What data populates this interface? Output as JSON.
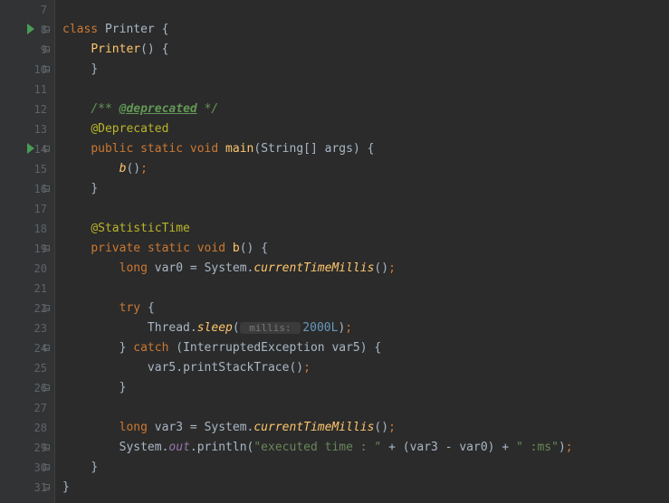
{
  "lines": [
    {
      "num": 7,
      "indent": 0,
      "tokens": []
    },
    {
      "num": 8,
      "indent": 0,
      "run": true,
      "fold": true,
      "tokens": [
        [
          "kw",
          "class"
        ],
        [
          "sp",
          " "
        ],
        [
          "cls",
          "Printer"
        ],
        [
          "sp",
          " "
        ],
        [
          "paren",
          "{"
        ]
      ]
    },
    {
      "num": 9,
      "indent": 1,
      "fold": true,
      "tokens": [
        [
          "method",
          "Printer"
        ],
        [
          "paren",
          "()"
        ],
        [
          "sp",
          " "
        ],
        [
          "paren",
          "{"
        ]
      ]
    },
    {
      "num": 10,
      "indent": 1,
      "fold": true,
      "tokens": [
        [
          "paren",
          "}"
        ]
      ]
    },
    {
      "num": 11,
      "indent": 0,
      "tokens": []
    },
    {
      "num": 12,
      "indent": 1,
      "tokens": [
        [
          "comment",
          "/** "
        ],
        [
          "doc-tag",
          "@deprecated"
        ],
        [
          "comment",
          " */"
        ]
      ]
    },
    {
      "num": 13,
      "indent": 1,
      "tokens": [
        [
          "ann",
          "@Deprecated"
        ]
      ]
    },
    {
      "num": 14,
      "indent": 1,
      "run": true,
      "fold": true,
      "tokens": [
        [
          "kw",
          "public"
        ],
        [
          "sp",
          " "
        ],
        [
          "kw",
          "static"
        ],
        [
          "sp",
          " "
        ],
        [
          "kw",
          "void"
        ],
        [
          "sp",
          " "
        ],
        [
          "method",
          "main"
        ],
        [
          "paren",
          "("
        ],
        [
          "type",
          "String"
        ],
        [
          "paren",
          "[]"
        ],
        [
          "sp",
          " "
        ],
        [
          "type",
          "args"
        ],
        [
          "paren",
          ")"
        ],
        [
          "sp",
          " "
        ],
        [
          "paren",
          "{"
        ]
      ]
    },
    {
      "num": 15,
      "indent": 2,
      "tokens": [
        [
          "static-method",
          "b"
        ],
        [
          "paren",
          "()"
        ],
        [
          "semi",
          ";"
        ]
      ]
    },
    {
      "num": 16,
      "indent": 1,
      "fold": true,
      "tokens": [
        [
          "paren",
          "}"
        ]
      ]
    },
    {
      "num": 17,
      "indent": 0,
      "tokens": []
    },
    {
      "num": 18,
      "indent": 1,
      "tokens": [
        [
          "ann",
          "@StatisticTime"
        ]
      ]
    },
    {
      "num": 19,
      "indent": 1,
      "fold": true,
      "tokens": [
        [
          "kw",
          "private"
        ],
        [
          "sp",
          " "
        ],
        [
          "kw",
          "static"
        ],
        [
          "sp",
          " "
        ],
        [
          "kw",
          "void"
        ],
        [
          "sp",
          " "
        ],
        [
          "method",
          "b"
        ],
        [
          "paren",
          "()"
        ],
        [
          "sp",
          " "
        ],
        [
          "paren",
          "{"
        ]
      ]
    },
    {
      "num": 20,
      "indent": 2,
      "tokens": [
        [
          "kw",
          "long"
        ],
        [
          "sp",
          " "
        ],
        [
          "type",
          "var0"
        ],
        [
          "sp",
          " "
        ],
        [
          "op",
          "="
        ],
        [
          "sp",
          " "
        ],
        [
          "type",
          "System"
        ],
        [
          "op",
          "."
        ],
        [
          "static-method",
          "currentTimeMillis"
        ],
        [
          "paren",
          "()"
        ],
        [
          "semi",
          ";"
        ]
      ]
    },
    {
      "num": 21,
      "indent": 0,
      "tokens": []
    },
    {
      "num": 22,
      "indent": 2,
      "fold": true,
      "tokens": [
        [
          "kw",
          "try"
        ],
        [
          "sp",
          " "
        ],
        [
          "paren",
          "{"
        ]
      ]
    },
    {
      "num": 23,
      "indent": 3,
      "tokens": [
        [
          "type",
          "Thread"
        ],
        [
          "op",
          "."
        ],
        [
          "static-method",
          "sleep"
        ],
        [
          "paren",
          "("
        ],
        [
          "param-hint",
          " millis: "
        ],
        [
          "num",
          "2000L"
        ],
        [
          "paren",
          ")"
        ],
        [
          "semi",
          ";"
        ]
      ]
    },
    {
      "num": 24,
      "indent": 2,
      "fold": true,
      "tokens": [
        [
          "paren",
          "}"
        ],
        [
          "sp",
          " "
        ],
        [
          "kw",
          "catch"
        ],
        [
          "sp",
          " "
        ],
        [
          "paren",
          "("
        ],
        [
          "type",
          "InterruptedException"
        ],
        [
          "sp",
          " "
        ],
        [
          "type",
          "var5"
        ],
        [
          "paren",
          ")"
        ],
        [
          "sp",
          " "
        ],
        [
          "paren",
          "{"
        ]
      ]
    },
    {
      "num": 25,
      "indent": 3,
      "tokens": [
        [
          "type",
          "var5"
        ],
        [
          "op",
          "."
        ],
        [
          "type",
          "printStackTrace"
        ],
        [
          "paren",
          "()"
        ],
        [
          "semi",
          ";"
        ]
      ]
    },
    {
      "num": 26,
      "indent": 2,
      "fold": true,
      "tokens": [
        [
          "paren",
          "}"
        ]
      ]
    },
    {
      "num": 27,
      "indent": 0,
      "tokens": []
    },
    {
      "num": 28,
      "indent": 2,
      "tokens": [
        [
          "kw",
          "long"
        ],
        [
          "sp",
          " "
        ],
        [
          "type",
          "var3"
        ],
        [
          "sp",
          " "
        ],
        [
          "op",
          "="
        ],
        [
          "sp",
          " "
        ],
        [
          "type",
          "System"
        ],
        [
          "op",
          "."
        ],
        [
          "static-method",
          "currentTimeMillis"
        ],
        [
          "paren",
          "()"
        ],
        [
          "semi",
          ";"
        ]
      ]
    },
    {
      "num": 29,
      "indent": 2,
      "fold": true,
      "tokens": [
        [
          "type",
          "System"
        ],
        [
          "op",
          "."
        ],
        [
          "static-field",
          "out"
        ],
        [
          "op",
          "."
        ],
        [
          "type",
          "println"
        ],
        [
          "paren",
          "("
        ],
        [
          "string",
          "\"executed time : \""
        ],
        [
          "sp",
          " "
        ],
        [
          "op",
          "+"
        ],
        [
          "sp",
          " "
        ],
        [
          "paren",
          "("
        ],
        [
          "type",
          "var3"
        ],
        [
          "sp",
          " "
        ],
        [
          "op",
          "-"
        ],
        [
          "sp",
          " "
        ],
        [
          "type",
          "var0"
        ],
        [
          "paren",
          ")"
        ],
        [
          "sp",
          " "
        ],
        [
          "op",
          "+"
        ],
        [
          "sp",
          " "
        ],
        [
          "string",
          "\" :ms\""
        ],
        [
          "paren",
          ")"
        ],
        [
          "semi",
          ";"
        ]
      ]
    },
    {
      "num": 30,
      "indent": 1,
      "fold": true,
      "tokens": [
        [
          "paren",
          "}"
        ]
      ]
    },
    {
      "num": 31,
      "indent": 0,
      "fold": true,
      "tokens": [
        [
          "paren",
          "}"
        ]
      ]
    }
  ],
  "indent_unit": "    "
}
